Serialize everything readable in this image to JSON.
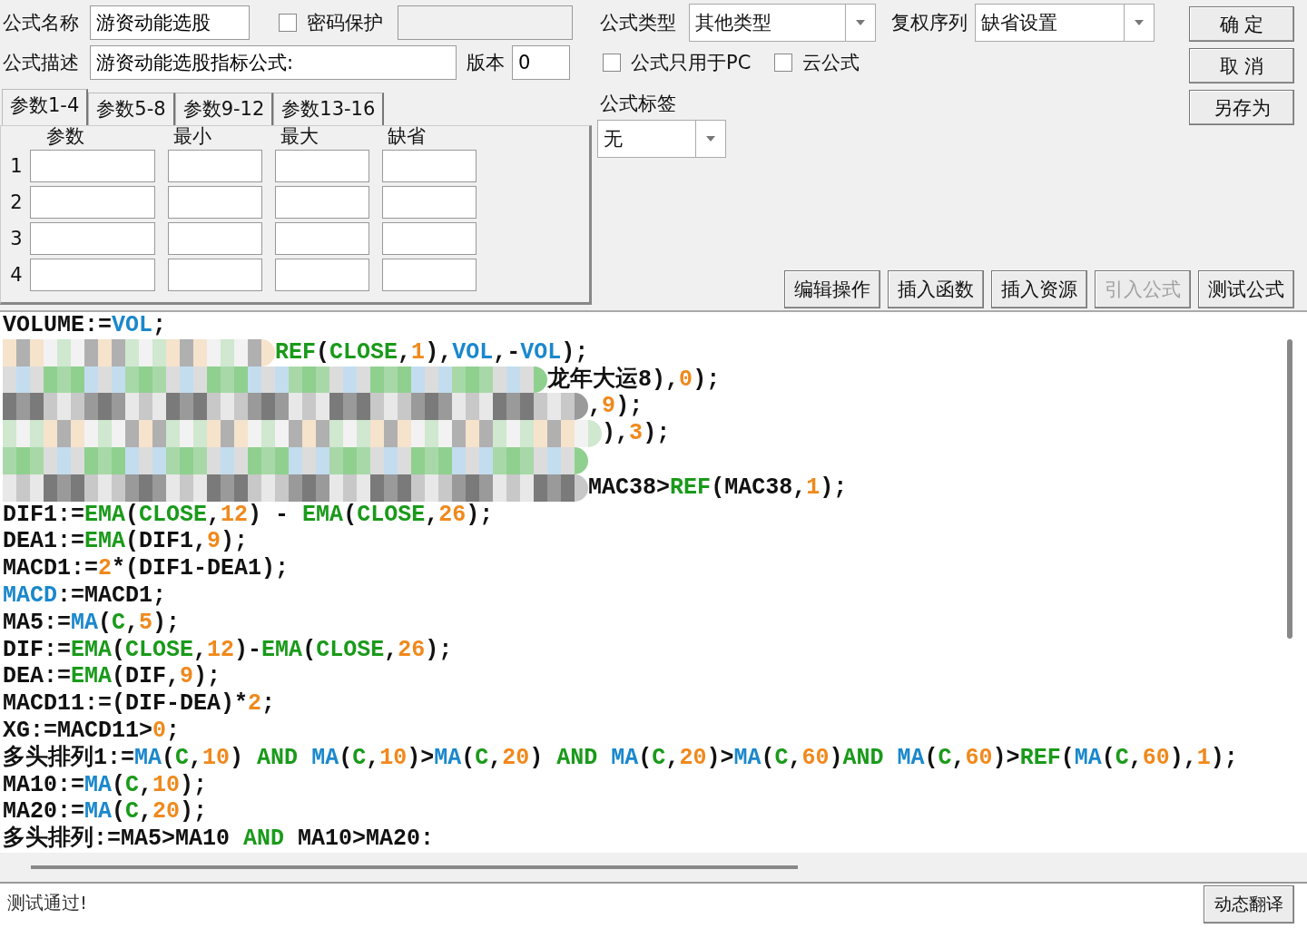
{
  "formula_name": {
    "label": "公式名称",
    "value": "游资动能选股"
  },
  "password": {
    "label": "密码保护",
    "checked": false
  },
  "description": {
    "label": "公式描述",
    "value": "游资动能选股指标公式:"
  },
  "version": {
    "label": "版本",
    "value": "0"
  },
  "param_tabs": [
    {
      "label": "参数1-4",
      "selected": true
    },
    {
      "label": "参数5-8",
      "selected": false
    },
    {
      "label": "参数9-12",
      "selected": false
    },
    {
      "label": "参数13-16",
      "selected": false
    }
  ],
  "param_columns": [
    "参数",
    "最小",
    "最大",
    "缺省"
  ],
  "param_rows": [
    "1",
    "2",
    "3",
    "4"
  ],
  "formula_type": {
    "label": "公式类型",
    "value": "其他类型"
  },
  "adjust_series": {
    "label": "复权序列",
    "value": "缺省设置"
  },
  "options": [
    {
      "label": "公式只用于PC",
      "checked": false
    },
    {
      "label": "云公式",
      "checked": false
    }
  ],
  "tag": {
    "label": "公式标签",
    "value": "无"
  },
  "dialog_buttons": [
    "确 定",
    "取 消",
    "另存为"
  ],
  "tool_buttons": [
    {
      "label": "编辑操作",
      "disabled": false
    },
    {
      "label": "插入函数",
      "disabled": false
    },
    {
      "label": "插入资源",
      "disabled": false
    },
    {
      "label": "引入公式",
      "disabled": true
    },
    {
      "label": "测试公式",
      "disabled": false
    }
  ],
  "code_lines": [
    {
      "tokens": [
        {
          "kind": "t",
          "text": "VOLUME:="
        },
        {
          "kind": "b",
          "text": "VOL"
        },
        {
          "kind": "t",
          "text": ";"
        }
      ]
    },
    {
      "masked": true,
      "tokens": [
        {
          "kind": "g",
          "text": "REF"
        },
        {
          "kind": "t",
          "text": "("
        },
        {
          "kind": "g",
          "text": "CLOSE"
        },
        {
          "kind": "t",
          "text": ","
        },
        {
          "kind": "n",
          "text": "1"
        },
        {
          "kind": "t",
          "text": "),"
        },
        {
          "kind": "b",
          "text": "VOL"
        },
        {
          "kind": "t",
          "text": ",-"
        },
        {
          "kind": "b",
          "text": "VOL"
        },
        {
          "kind": "t",
          "text": ");"
        }
      ]
    },
    {
      "masked": true,
      "tokens": [
        {
          "kind": "t",
          "text": "龙年大运8),"
        },
        {
          "kind": "n",
          "text": "0"
        },
        {
          "kind": "t",
          "text": ");"
        }
      ]
    },
    {
      "masked": true,
      "tokens": [
        {
          "kind": "t",
          "text": ","
        },
        {
          "kind": "n",
          "text": "9"
        },
        {
          "kind": "t",
          "text": ");"
        }
      ]
    },
    {
      "masked": true,
      "tokens": [
        {
          "kind": "t",
          "text": "),"
        },
        {
          "kind": "n",
          "text": "3"
        },
        {
          "kind": "t",
          "text": ");"
        }
      ]
    },
    {
      "masked": true
    },
    {
      "masked": true,
      "tokens": [
        {
          "kind": "t",
          "text": "MAC38>"
        },
        {
          "kind": "g",
          "text": "REF"
        },
        {
          "kind": "t",
          "text": "(MAC38,"
        },
        {
          "kind": "n",
          "text": "1"
        },
        {
          "kind": "t",
          "text": ");"
        }
      ]
    },
    {
      "tokens": [
        {
          "kind": "t",
          "text": "DIF1:="
        },
        {
          "kind": "g",
          "text": "EMA"
        },
        {
          "kind": "t",
          "text": "("
        },
        {
          "kind": "g",
          "text": "CLOSE"
        },
        {
          "kind": "t",
          "text": ","
        },
        {
          "kind": "n",
          "text": "12"
        },
        {
          "kind": "t",
          "text": ") - "
        },
        {
          "kind": "g",
          "text": "EMA"
        },
        {
          "kind": "t",
          "text": "("
        },
        {
          "kind": "g",
          "text": "CLOSE"
        },
        {
          "kind": "t",
          "text": ","
        },
        {
          "kind": "n",
          "text": "26"
        },
        {
          "kind": "t",
          "text": ");"
        }
      ]
    },
    {
      "tokens": [
        {
          "kind": "t",
          "text": "DEA1:="
        },
        {
          "kind": "g",
          "text": "EMA"
        },
        {
          "kind": "t",
          "text": "(DIF1,"
        },
        {
          "kind": "n",
          "text": "9"
        },
        {
          "kind": "t",
          "text": ");"
        }
      ]
    },
    {
      "tokens": [
        {
          "kind": "t",
          "text": "MACD1:="
        },
        {
          "kind": "n",
          "text": "2"
        },
        {
          "kind": "t",
          "text": "*(DIF1-DEA1);"
        }
      ]
    },
    {
      "tokens": [
        {
          "kind": "b",
          "text": "MACD"
        },
        {
          "kind": "t",
          "text": ":=MACD1;"
        }
      ]
    },
    {
      "tokens": [
        {
          "kind": "t",
          "text": "MA5:="
        },
        {
          "kind": "b",
          "text": "MA"
        },
        {
          "kind": "t",
          "text": "("
        },
        {
          "kind": "g",
          "text": "C"
        },
        {
          "kind": "t",
          "text": ","
        },
        {
          "kind": "n",
          "text": "5"
        },
        {
          "kind": "t",
          "text": ");"
        }
      ]
    },
    {
      "tokens": [
        {
          "kind": "t",
          "text": "DIF:="
        },
        {
          "kind": "g",
          "text": "EMA"
        },
        {
          "kind": "t",
          "text": "("
        },
        {
          "kind": "g",
          "text": "CLOSE"
        },
        {
          "kind": "t",
          "text": ","
        },
        {
          "kind": "n",
          "text": "12"
        },
        {
          "kind": "t",
          "text": ")-"
        },
        {
          "kind": "g",
          "text": "EMA"
        },
        {
          "kind": "t",
          "text": "("
        },
        {
          "kind": "g",
          "text": "CLOSE"
        },
        {
          "kind": "t",
          "text": ","
        },
        {
          "kind": "n",
          "text": "26"
        },
        {
          "kind": "t",
          "text": ");"
        }
      ]
    },
    {
      "tokens": [
        {
          "kind": "t",
          "text": "DEA:="
        },
        {
          "kind": "g",
          "text": "EMA"
        },
        {
          "kind": "t",
          "text": "(DIF,"
        },
        {
          "kind": "n",
          "text": "9"
        },
        {
          "kind": "t",
          "text": ");"
        }
      ]
    },
    {
      "tokens": [
        {
          "kind": "t",
          "text": "MACD11:=(DIF-DEA)*"
        },
        {
          "kind": "n",
          "text": "2"
        },
        {
          "kind": "t",
          "text": ";"
        }
      ]
    },
    {
      "tokens": [
        {
          "kind": "t",
          "text": "XG:=MACD11>"
        },
        {
          "kind": "n",
          "text": "0"
        },
        {
          "kind": "t",
          "text": ";"
        }
      ]
    },
    {
      "tokens": [
        {
          "kind": "t",
          "text": "多头排列1:="
        },
        {
          "kind": "b",
          "text": "MA"
        },
        {
          "kind": "t",
          "text": "("
        },
        {
          "kind": "g",
          "text": "C"
        },
        {
          "kind": "t",
          "text": ","
        },
        {
          "kind": "n",
          "text": "10"
        },
        {
          "kind": "t",
          "text": ") "
        },
        {
          "kind": "g",
          "text": "AND "
        },
        {
          "kind": "b",
          "text": "MA"
        },
        {
          "kind": "t",
          "text": "("
        },
        {
          "kind": "g",
          "text": "C"
        },
        {
          "kind": "t",
          "text": ","
        },
        {
          "kind": "n",
          "text": "10"
        },
        {
          "kind": "t",
          "text": ")>"
        },
        {
          "kind": "b",
          "text": "MA"
        },
        {
          "kind": "t",
          "text": "("
        },
        {
          "kind": "g",
          "text": "C"
        },
        {
          "kind": "t",
          "text": ","
        },
        {
          "kind": "n",
          "text": "20"
        },
        {
          "kind": "t",
          "text": ") "
        },
        {
          "kind": "g",
          "text": "AND "
        },
        {
          "kind": "b",
          "text": "MA"
        },
        {
          "kind": "t",
          "text": "("
        },
        {
          "kind": "g",
          "text": "C"
        },
        {
          "kind": "t",
          "text": ","
        },
        {
          "kind": "n",
          "text": "20"
        },
        {
          "kind": "t",
          "text": ")>"
        },
        {
          "kind": "b",
          "text": "MA"
        },
        {
          "kind": "t",
          "text": "("
        },
        {
          "kind": "g",
          "text": "C"
        },
        {
          "kind": "t",
          "text": ","
        },
        {
          "kind": "n",
          "text": "60"
        },
        {
          "kind": "t",
          "text": ")"
        },
        {
          "kind": "g",
          "text": "AND "
        },
        {
          "kind": "b",
          "text": "MA"
        },
        {
          "kind": "t",
          "text": "("
        },
        {
          "kind": "g",
          "text": "C"
        },
        {
          "kind": "t",
          "text": ","
        },
        {
          "kind": "n",
          "text": "60"
        },
        {
          "kind": "t",
          "text": ")>"
        },
        {
          "kind": "g",
          "text": "REF"
        },
        {
          "kind": "t",
          "text": "("
        },
        {
          "kind": "b",
          "text": "MA"
        },
        {
          "kind": "t",
          "text": "("
        },
        {
          "kind": "g",
          "text": "C"
        },
        {
          "kind": "t",
          "text": ","
        },
        {
          "kind": "n",
          "text": "60"
        },
        {
          "kind": "t",
          "text": "),"
        },
        {
          "kind": "n",
          "text": "1"
        },
        {
          "kind": "t",
          "text": ");"
        }
      ]
    },
    {
      "tokens": [
        {
          "kind": "t",
          "text": "MA10:="
        },
        {
          "kind": "b",
          "text": "MA"
        },
        {
          "kind": "t",
          "text": "("
        },
        {
          "kind": "g",
          "text": "C"
        },
        {
          "kind": "t",
          "text": ","
        },
        {
          "kind": "n",
          "text": "10"
        },
        {
          "kind": "t",
          "text": ");"
        }
      ]
    },
    {
      "tokens": [
        {
          "kind": "t",
          "text": "MA20:="
        },
        {
          "kind": "b",
          "text": "MA"
        },
        {
          "kind": "t",
          "text": "("
        },
        {
          "kind": "g",
          "text": "C"
        },
        {
          "kind": "t",
          "text": ","
        },
        {
          "kind": "n",
          "text": "20"
        },
        {
          "kind": "t",
          "text": ");"
        }
      ]
    },
    {
      "tokens": [
        {
          "kind": "t",
          "text": "多头排列:=MA5>MA10 "
        },
        {
          "kind": "g",
          "text": "AND "
        },
        {
          "kind": "t",
          "text": "MA10>MA20:"
        }
      ]
    }
  ],
  "message": "测试通过!",
  "side_button": "动态翻译"
}
